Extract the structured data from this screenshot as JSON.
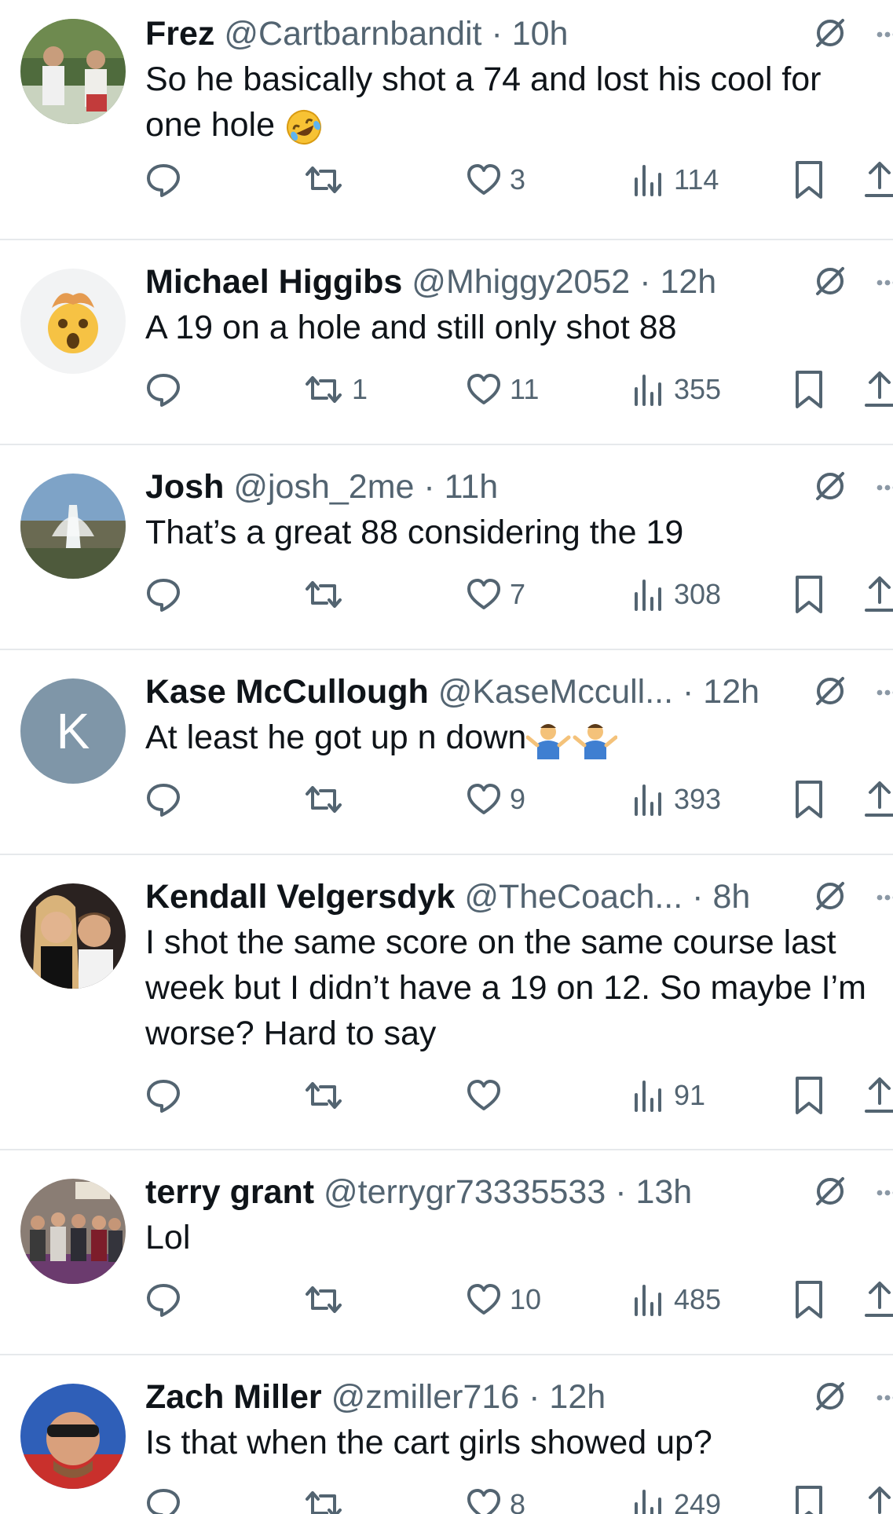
{
  "colors": {
    "text_primary": "#0f1419",
    "text_secondary": "#536471",
    "divider": "#e6e9ec",
    "letter_avatar_bg": "#7f96a8"
  },
  "icons": {
    "reply": "speech-bubble",
    "retweet": "two-arrows-loop",
    "like": "heart-outline",
    "views": "bar-chart",
    "bookmark": "bookmark-outline",
    "share": "upload-arrow",
    "grok": "slashed-circle",
    "more": "three-dots"
  },
  "replies": [
    {
      "display_name": "Frez",
      "handle": "@Cartbarnbandit",
      "separator": "·",
      "time": "10h",
      "text": "So he basically shot a 74 and lost his cool for one hole",
      "emoji": "rolling-on-floor-laughing",
      "retweets": "",
      "likes": "3",
      "views": "114"
    },
    {
      "display_name": "Michael Higgibs",
      "handle": "@Mhiggy2052",
      "separator": "·",
      "time": "12h",
      "text": "A 19 on a hole and still only shot 88",
      "retweets": "1",
      "likes": "11",
      "views": "355"
    },
    {
      "display_name": "Josh",
      "handle": "@josh_2me",
      "separator": "·",
      "time": "11h",
      "text": "That’s a great 88 considering the 19",
      "retweets": "",
      "likes": "7",
      "views": "308"
    },
    {
      "display_name": "Kase McCullough",
      "handle": "@KaseMccull...",
      "separator": "·",
      "time": "12h",
      "text": "At least he got up n down",
      "emoji": "man-shrugging-x2",
      "avatar_letter": "K",
      "retweets": "",
      "likes": "9",
      "views": "393"
    },
    {
      "display_name": "Kendall Velgersdyk",
      "handle": "@TheCoach...",
      "separator": "·",
      "time": "8h",
      "text": "I shot the same score on the same course last week but I didn’t have a 19 on 12. So maybe I’m worse? Hard to say",
      "retweets": "",
      "likes": "",
      "views": "91"
    },
    {
      "display_name": "terry grant",
      "handle": "@terrygr73335533",
      "separator": "·",
      "time": "13h",
      "text": "Lol",
      "retweets": "",
      "likes": "10",
      "views": "485"
    },
    {
      "display_name": "Zach Miller",
      "handle": "@zmiller716",
      "separator": "·",
      "time": "12h",
      "text": "Is that when the cart girls showed up?",
      "retweets": "",
      "likes": "8",
      "views": "249"
    }
  ]
}
